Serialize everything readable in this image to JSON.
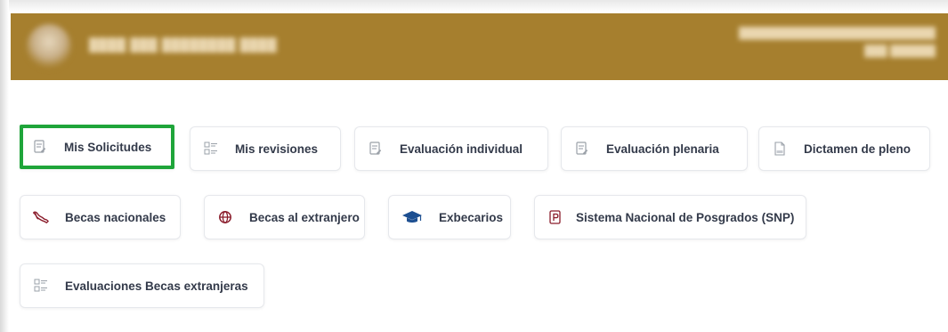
{
  "menu": {
    "row1": [
      {
        "label": "Mis Solicitudes",
        "icon": "document-edit-icon"
      },
      {
        "label": "Mis revisiones",
        "icon": "checklist-icon"
      },
      {
        "label": "Evaluación individual",
        "icon": "document-edit-icon"
      },
      {
        "label": "Evaluación plenaria",
        "icon": "document-edit-icon"
      },
      {
        "label": "Dictamen de pleno",
        "icon": "pdf-file-icon"
      }
    ],
    "row2": [
      {
        "label": "Becas nacionales",
        "icon": "mexico-map-icon"
      },
      {
        "label": "Becas al extranjero",
        "icon": "globe-icon"
      },
      {
        "label": "Exbecarios",
        "icon": "graduation-cap-icon"
      },
      {
        "label": "Sistema Nacional de Posgrados (SNP)",
        "icon": "p-square-icon"
      }
    ],
    "row3": [
      {
        "label": "Evaluaciones Becas extranjeras",
        "icon": "checklist-icon"
      }
    ]
  },
  "colors": {
    "header_bg": "#a67f2e",
    "selected_border": "#1fa53a",
    "label_text": "#333a4a",
    "icon_gray": "#9aa0a8",
    "icon_accent": "#8a1c2b",
    "icon_blue": "#1d4f91"
  }
}
